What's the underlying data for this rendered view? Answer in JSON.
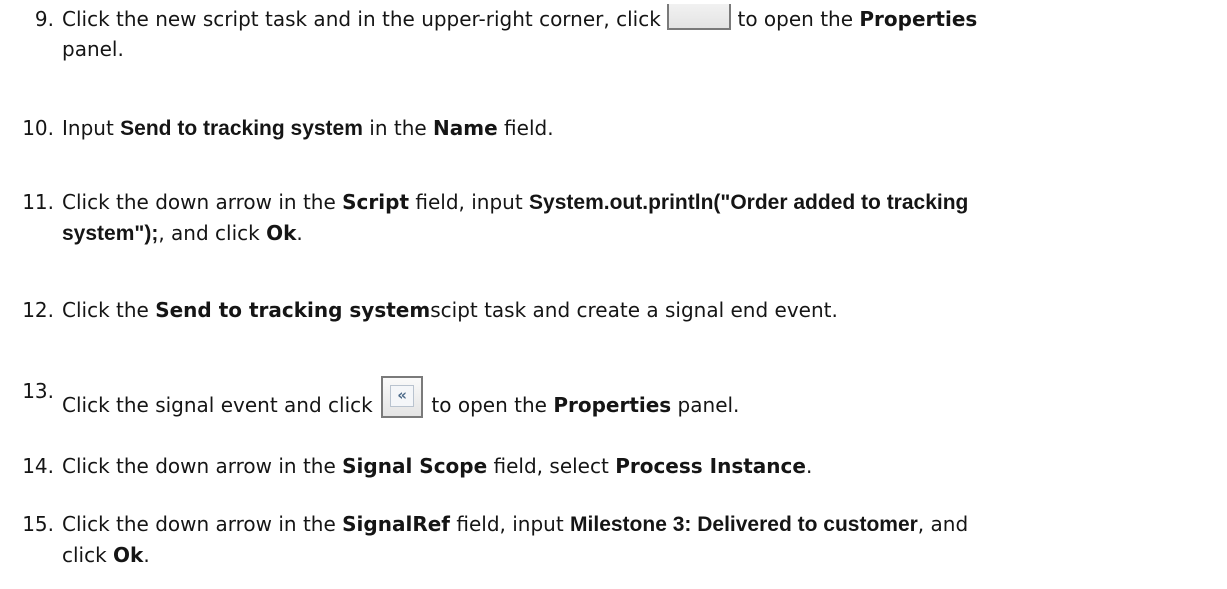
{
  "steps": [
    {
      "number": "9.",
      "parts": {
        "p1": "Click the new script task and in the upper-right corner, click ",
        "icon_glyph": "«",
        "p2": " to open the ",
        "b1": "Properties",
        "p3": "panel."
      }
    },
    {
      "number": "10.",
      "parts": {
        "p1": "Input ",
        "b1": "Send to tracking system",
        "p2": " in the ",
        "b2": "Name",
        "p3": " field."
      }
    },
    {
      "number": "11.",
      "parts": {
        "p1": "Click the down arrow in the ",
        "b1": "Script",
        "p2": " field, input ",
        "b2": "System.out.println(\"Order added to tracking",
        "b3": "system\");",
        "p3": ", and click ",
        "b4": "Ok",
        "p4": "."
      }
    },
    {
      "number": "12.",
      "parts": {
        "p1": "Click the ",
        "b1": "Send to tracking system",
        "p2": "scipt task and create a signal end event."
      }
    },
    {
      "number": "13.",
      "parts": {
        "p1": "Click the signal event and click ",
        "icon_glyph": "«",
        "p2": " to open the ",
        "b1": "Properties",
        "p3": " panel."
      }
    },
    {
      "number": "14.",
      "parts": {
        "p1": "Click the down arrow in the ",
        "b1": "Signal Scope",
        "p2": " field, select ",
        "b2": "Process Instance",
        "p3": "."
      }
    },
    {
      "number": "15.",
      "parts": {
        "p1": "Click the down arrow in the ",
        "b1": "SignalRef",
        "p2": " field, input ",
        "b2": "Milestone 3: Delivered to customer",
        "p3": ", and",
        "p4": "click ",
        "b3": "Ok",
        "p5": "."
      }
    }
  ],
  "icons": {
    "collapse_button": "double-chevron-left-icon"
  }
}
